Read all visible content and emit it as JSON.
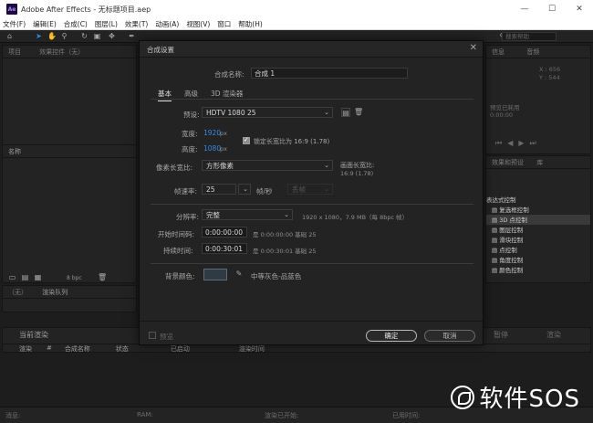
{
  "window": {
    "title": "Adobe After Effects - 无标题项目.aep",
    "logo": "Ae"
  },
  "menu": [
    "文件(F)",
    "编辑(E)",
    "合成(C)",
    "图层(L)",
    "效果(T)",
    "动画(A)",
    "视图(V)",
    "窗口",
    "帮助(H)"
  ],
  "toolbar": {
    "search_placeholder": "搜索帮助"
  },
  "background": {
    "project_tab": "项目",
    "effects_tab": "效果控件（无）",
    "name_col": "名称",
    "info_tab": "信息",
    "audio_tab": "音频",
    "info_x": "X : 656",
    "info_y": "Y : 544",
    "preview_text": "预览已耗用",
    "time": "0:00:00",
    "effects_preset_tab": "效果和预设",
    "effects_preset_hint": "库",
    "effects_list": [
      "表达式控制",
      "复选框控制",
      "3D 点控制",
      "图层控制",
      "滑块控制",
      "点控制",
      "角度控制",
      "颜色控制"
    ],
    "bpc": "8 bpc",
    "none_tab": "（无）",
    "render_queue_tab": "渲染队列",
    "current_render": "当前渲染",
    "render_cols": [
      "渲染",
      "#",
      "合成名称",
      "状态",
      "已启动",
      "渲染时间"
    ],
    "pause_btn": "暂停",
    "render_btn": "渲染",
    "status_left": "消息:",
    "status_ram": "RAM:",
    "status_queue": "渲染已开始:",
    "status_elapsed": "已用时间:"
  },
  "dialog": {
    "title": "合成设置",
    "comp_name_label": "合成名称:",
    "comp_name_value": "合成 1",
    "tabs": [
      "基本",
      "高级",
      "3D 渲染器"
    ],
    "preset_label": "预设:",
    "preset_value": "HDTV 1080 25",
    "width_label": "宽度:",
    "width_value": "1920",
    "height_label": "高度:",
    "height_value": "1080",
    "px": "px",
    "lock_aspect_label": "锁定长宽比为 16:9 (1.78)",
    "lock_aspect_checked": true,
    "par_label": "像素长宽比:",
    "par_value": "方形像素",
    "frame_aspect_label": "画面长宽比:",
    "frame_aspect_value": "16:9 (1.78)",
    "fps_label": "帧速率:",
    "fps_value": "25",
    "fps_unit": "帧/秒",
    "drop_frame": "丢帧",
    "resolution_label": "分辨率:",
    "resolution_value": "完整",
    "resolution_info": "1920 x 1080，7.9 MB（每 8bpc 帧）",
    "start_tc_label": "开始时间码:",
    "start_tc_value": "0:00:00:00",
    "start_tc_info": "是 0:00:00:00  基础 25",
    "duration_label": "持续时间:",
    "duration_value": "0:00:30:01",
    "duration_info": "是 0:00:30:01  基础 25",
    "bg_color_label": "背景颜色:",
    "bg_color_hex": "#303a44",
    "bg_color_name": "中等灰色-品蓝色",
    "preview_label": "预览",
    "ok_label": "确定",
    "cancel_label": "取消"
  },
  "watermark": {
    "text": "软件SOS"
  }
}
